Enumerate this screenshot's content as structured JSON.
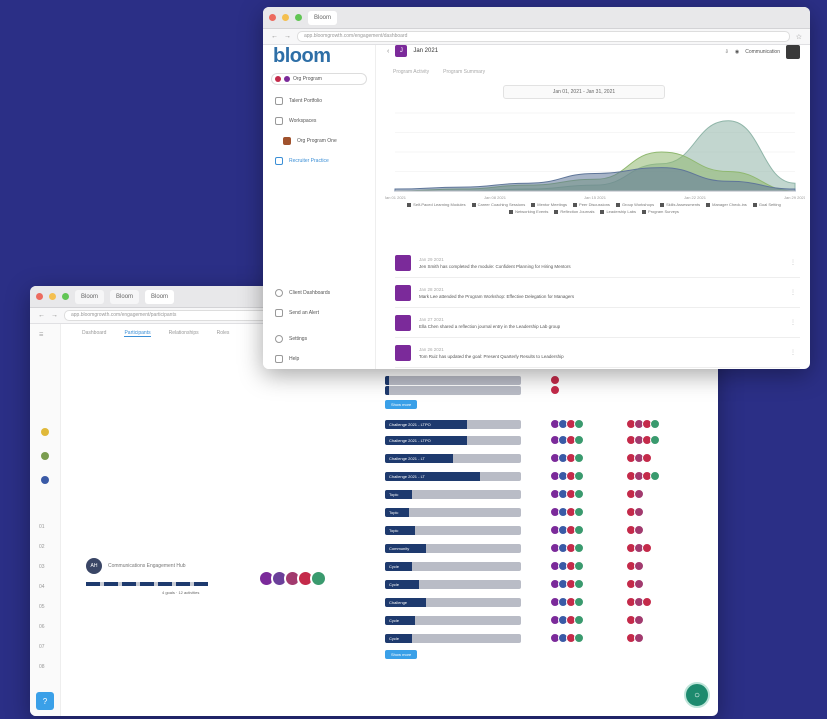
{
  "front": {
    "chrome": {
      "tab": "Bloom",
      "url": "app.bloomgrowth.com/engagement/dashboard"
    },
    "logo": "bloom",
    "org": {
      "name": "Org Program"
    },
    "nav": [
      {
        "label": "Talent Portfolio",
        "icon": "users-icon"
      },
      {
        "label": "Workspaces",
        "icon": "folder-icon"
      },
      {
        "label": "Org Program One",
        "icon": "square-icon"
      },
      {
        "label": "Recruiter Practice",
        "icon": "people-icon"
      }
    ],
    "nav_bottom": [
      {
        "label": "Client Dashboards",
        "icon": "gear-icon"
      },
      {
        "label": "Send an Alert",
        "icon": "bell-icon"
      },
      {
        "label": "Settings",
        "icon": "settings-icon"
      },
      {
        "label": "Help",
        "icon": "help-icon"
      }
    ],
    "header": {
      "title": "Jan 2021",
      "user": "Communication"
    },
    "tabs": [
      "Program Activity",
      "Program Summary"
    ],
    "date_range": "Jan 01, 2021 - Jan 31, 2021",
    "chart_data": {
      "type": "area",
      "x": [
        "Jan 01",
        "Jan 05",
        "Jan 10",
        "Jan 15",
        "Jan 20",
        "Jan 25",
        "Jan 31"
      ],
      "series": [
        {
          "values": [
            1,
            2,
            4,
            9,
            12,
            5,
            1
          ],
          "color": "#5f7699"
        },
        {
          "values": [
            0,
            1,
            3,
            6,
            20,
            10,
            0
          ],
          "color": "#8fb86f"
        },
        {
          "values": [
            0,
            0,
            1,
            3,
            14,
            36,
            4
          ],
          "color": "#8fb5a8"
        }
      ],
      "xlabels": [
        "Jan 01 2021",
        "Jan 08 2021",
        "Jan 15 2021",
        "Jan 22 2021",
        "Jan 29 2021"
      ],
      "ylim": [
        0,
        40
      ]
    },
    "legend": [
      "Self-Paced Learning Modules",
      "Career Coaching Sessions",
      "Mentor Meetings",
      "Peer Discussions",
      "Group Workshops",
      "Skills Assessments",
      "Manager Check-ins",
      "Goal Setting",
      "Networking Events",
      "Reflection Journals",
      "Leadership Labs",
      "Program Surveys"
    ],
    "feed": [
      {
        "date": "Jan 29 2021",
        "text": "Jen Smith has completed the module: Confident Planning for Hiring Mentors"
      },
      {
        "date": "Jan 28 2021",
        "text": "Mark Lee attended the Program Workshop: Effective Delegation for Managers"
      },
      {
        "date": "Jan 27 2021",
        "text": "Ella Chen shared a reflection journal entry in the Leadership Lab group"
      },
      {
        "date": "Jan 26 2021",
        "text": "Tom Ruiz has updated the goal: Present Quarterly Results to Leadership"
      }
    ]
  },
  "back": {
    "chrome": {
      "tabs": [
        "Bloom",
        "Bloom",
        "Bloom"
      ],
      "url": "app.bloomgrowth.com/engagement/participants"
    },
    "subtabs": [
      "Dashboard",
      "Participants",
      "Relationships",
      "Roles"
    ],
    "person": {
      "initials": "AH",
      "name": "Communications Engagement Hub",
      "meta": "4 goals  · 12 activities"
    },
    "rows": [
      {
        "label": "",
        "fill": 0
      },
      {
        "label": "",
        "fill": 0
      },
      {
        "label": "Challenge 2021 - LTPO",
        "fill": 60
      },
      {
        "label": "Challenge 2021 - LTPO",
        "fill": 60
      },
      {
        "label": "Challenge 2021 - LT",
        "fill": 50
      },
      {
        "label": "Challenge 2021 - LT",
        "fill": 70
      },
      {
        "label": "Topic",
        "fill": 20
      },
      {
        "label": "Topic",
        "fill": 18
      },
      {
        "label": "Topic",
        "fill": 22
      },
      {
        "label": "Community",
        "fill": 30
      },
      {
        "label": "Cycle",
        "fill": 20
      },
      {
        "label": "Cycle",
        "fill": 25
      },
      {
        "label": "Challenge",
        "fill": 30
      },
      {
        "label": "Cycle",
        "fill": 22
      },
      {
        "label": "Cycle",
        "fill": 20
      }
    ],
    "show_more": "Show more",
    "fab_icon": "chat-icon"
  }
}
